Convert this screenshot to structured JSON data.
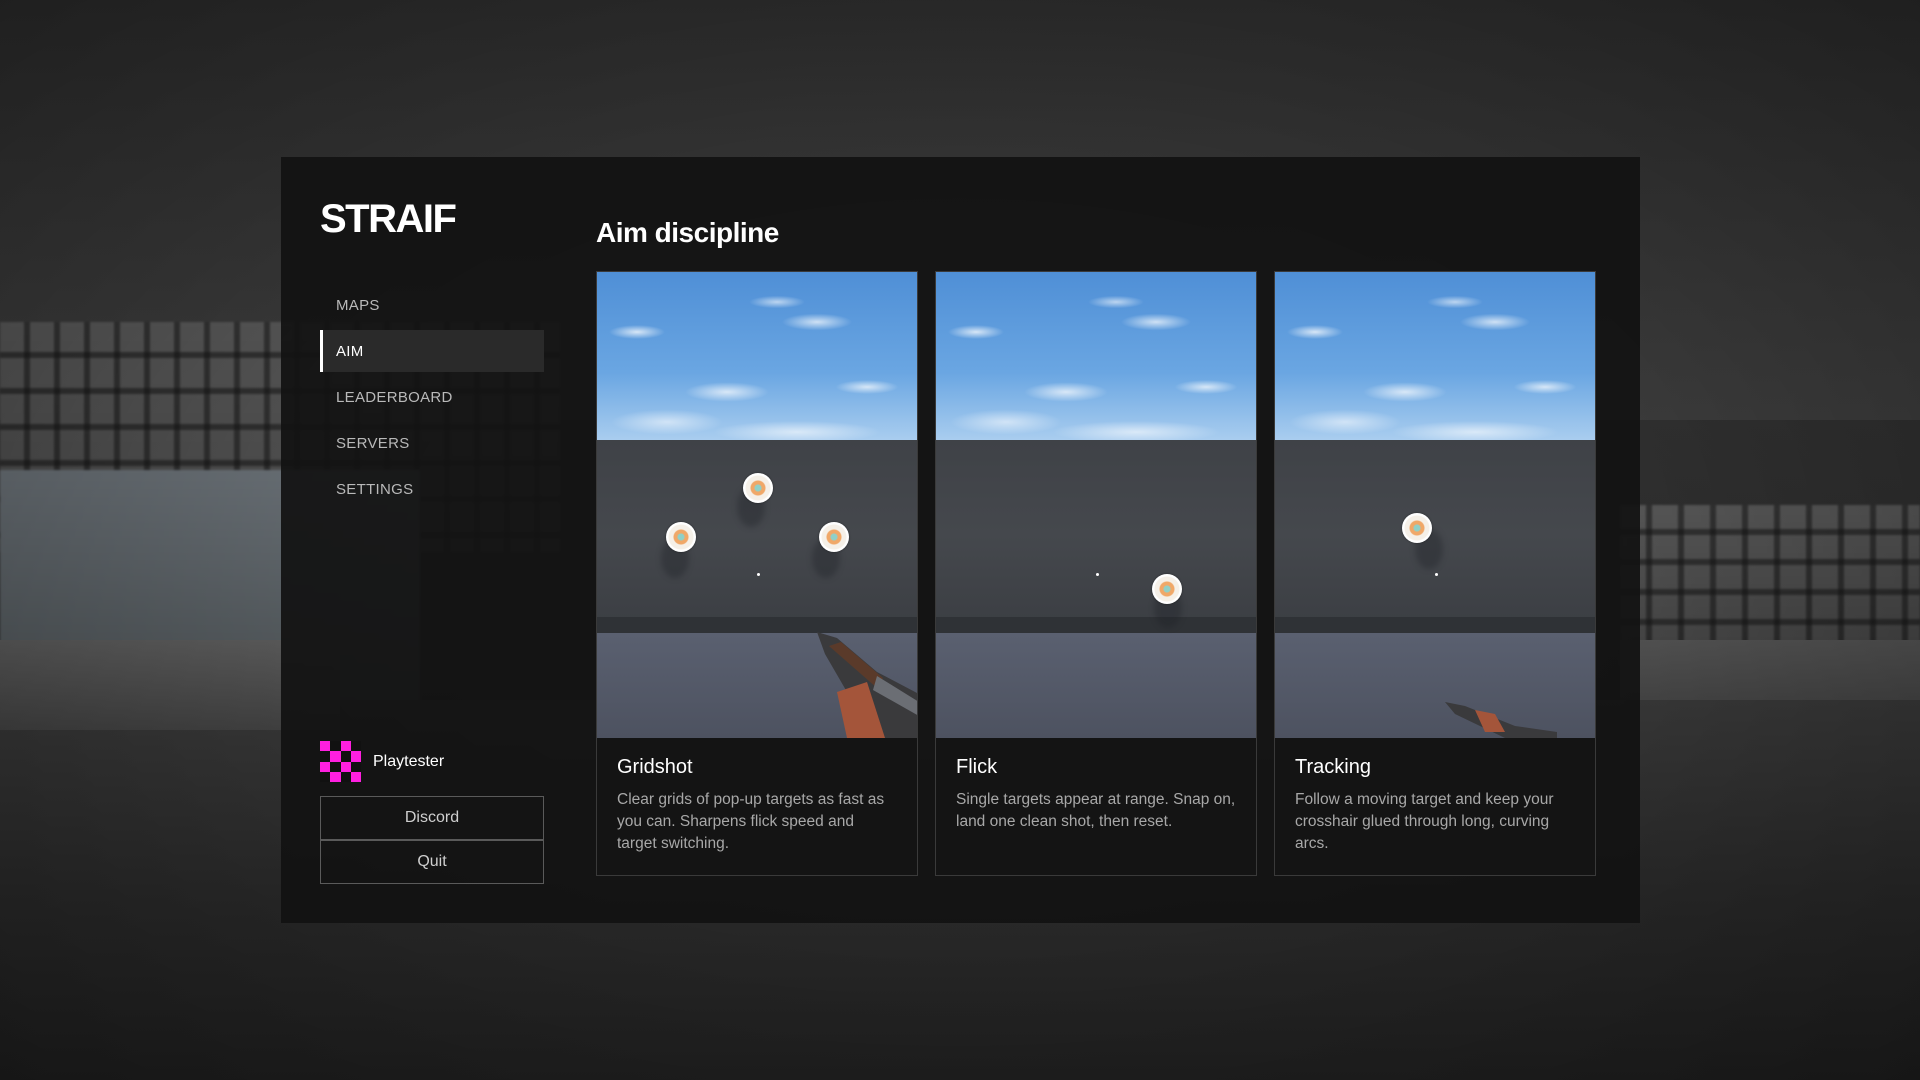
{
  "brand": {
    "logo": "STRAIF"
  },
  "nav": {
    "items": [
      {
        "label": "MAPS",
        "active": false
      },
      {
        "label": "AIM",
        "active": true
      },
      {
        "label": "LEADERBOARD",
        "active": false
      },
      {
        "label": "SERVERS",
        "active": false
      },
      {
        "label": "SETTINGS",
        "active": false
      }
    ]
  },
  "user": {
    "name": "Playtester",
    "avatar_icon": "checker-avatar-icon",
    "avatar_color": "#ff1fe0"
  },
  "buttons": {
    "discord": "Discord",
    "quit": "Quit"
  },
  "main": {
    "title": "Aim discipline",
    "cards": [
      {
        "title": "Gridshot",
        "description": "Clear grids of pop-up targets as fast as you can. Sharpens flick speed and target switching."
      },
      {
        "title": "Flick",
        "description": "Single targets appear at range. Snap on, land one clean shot, then reset."
      },
      {
        "title": "Tracking",
        "description": "Follow a moving target and keep your crosshair glued through long, curving arcs."
      }
    ]
  },
  "colors": {
    "panel": "#121212",
    "accent": "#ffffff",
    "sky": "#6aa6e2"
  }
}
